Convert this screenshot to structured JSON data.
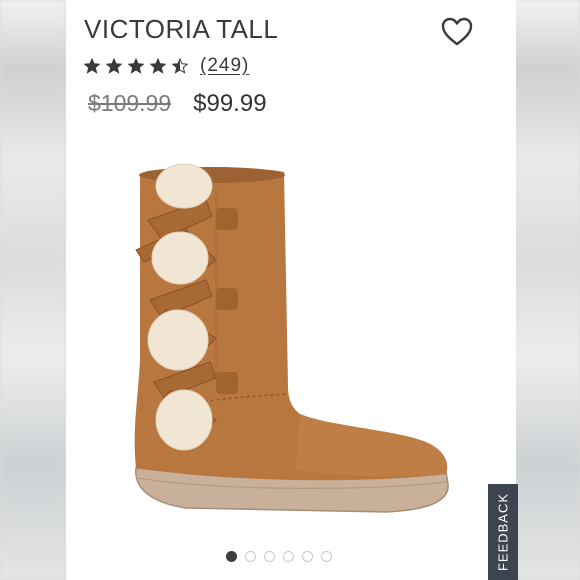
{
  "product": {
    "title": "VICTORIA TALL",
    "rating": 4.5,
    "rating_max": 5,
    "review_count": "(249)",
    "original_price": "$109.99",
    "sale_price": "$99.99"
  },
  "icons": {
    "wishlist": "heart-outline-icon",
    "star": "star-icon"
  },
  "gallery": {
    "image_count": 6,
    "active_index": 0
  },
  "feedback_tab": {
    "label": "FEEDBACK"
  },
  "colors": {
    "text": "#3a3a3a",
    "old_price": "#7a7a7a",
    "feedback_bg": "#3d4450",
    "dot_active": "#3e3e3e"
  }
}
